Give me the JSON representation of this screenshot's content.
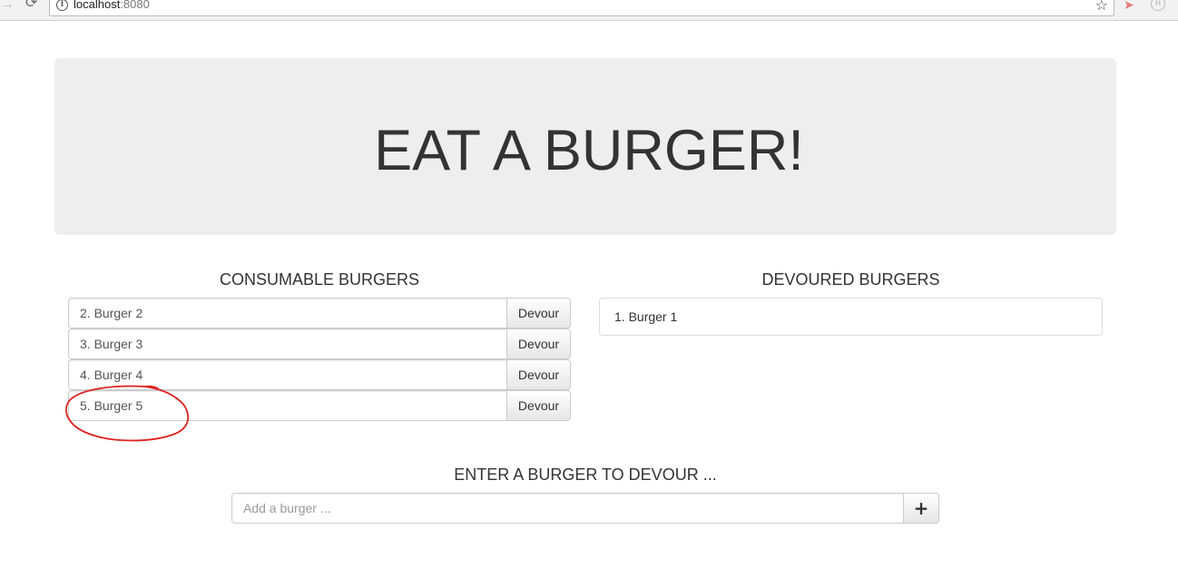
{
  "browser": {
    "url_host": "localhost",
    "url_port": ":8080",
    "icons": [
      "forward-icon",
      "reload-icon",
      "info-icon",
      "star-icon",
      "extension-icon",
      "extension-icon-2"
    ]
  },
  "header": {
    "title": "EAT A BURGER!"
  },
  "consumable": {
    "heading": "CONSUMABLE BURGERS",
    "items": [
      {
        "label": "2. Burger 2",
        "button": "Devour"
      },
      {
        "label": "3. Burger 3",
        "button": "Devour"
      },
      {
        "label": "4. Burger 4",
        "button": "Devour"
      },
      {
        "label": "5. Burger 5",
        "button": "Devour"
      }
    ]
  },
  "devoured": {
    "heading": "DEVOURED BURGERS",
    "items": [
      {
        "label": "1. Burger 1"
      }
    ]
  },
  "add_form": {
    "heading": "ENTER A BURGER TO DEVOUR ...",
    "placeholder": "Add a burger ...",
    "value": "",
    "button": "+"
  },
  "colors": {
    "jumbotron_bg": "#eeeeee",
    "annotation": "#e02020",
    "text": "#333333"
  }
}
